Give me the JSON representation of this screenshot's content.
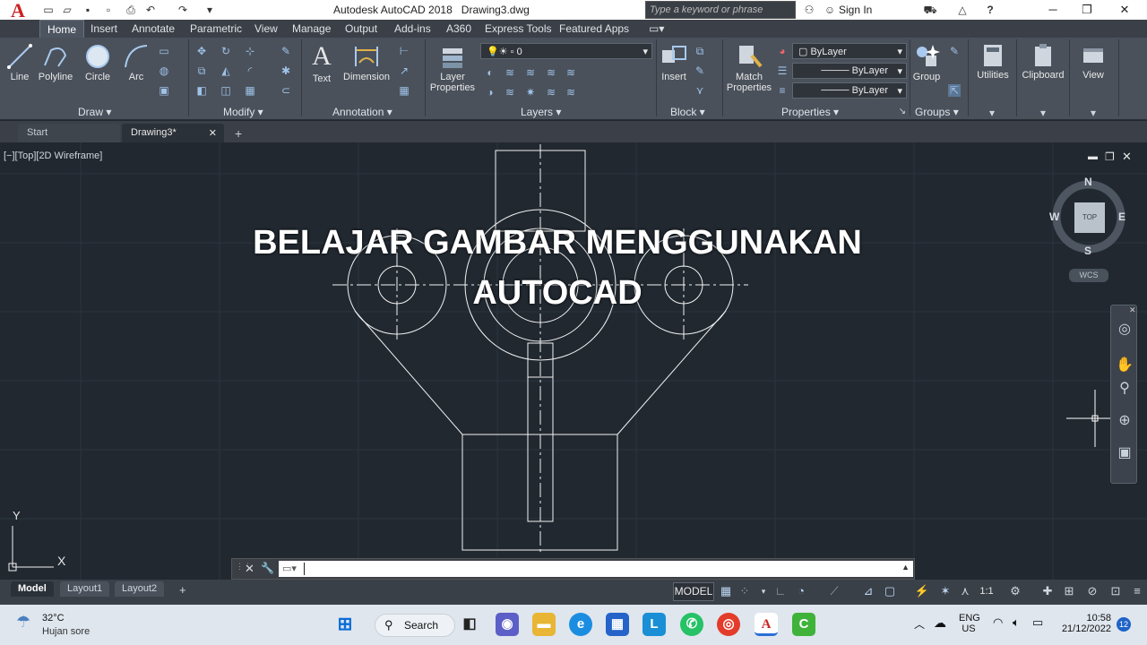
{
  "app": {
    "logo_letter": "A",
    "title": "Autodesk AutoCAD 2018",
    "document": "Drawing3.dwg",
    "search_placeholder": "Type a keyword or phrase",
    "signin_label": "Sign In",
    "help_label": "?"
  },
  "ribbon": {
    "tabs": [
      "Home",
      "Insert",
      "Annotate",
      "Parametric",
      "View",
      "Manage",
      "Output",
      "Add-ins",
      "A360",
      "Express Tools",
      "Featured Apps"
    ],
    "active_tab": "Home",
    "draw": {
      "title": "Draw",
      "line": "Line",
      "polyline": "Polyline",
      "circle": "Circle",
      "arc": "Arc"
    },
    "modify": {
      "title": "Modify"
    },
    "annotation": {
      "title": "Annotation",
      "text": "Text",
      "dimension": "Dimension"
    },
    "layers": {
      "title": "Layers",
      "layer_properties_1": "Layer",
      "layer_properties_2": "Properties",
      "current_layer": "0"
    },
    "block": {
      "title": "Block",
      "insert": "Insert"
    },
    "properties": {
      "title": "Properties",
      "match_1": "Match",
      "match_2": "Properties",
      "color": "ByLayer",
      "linetype": "ByLayer",
      "lineweight": "ByLayer"
    },
    "groups": {
      "title": "Groups",
      "group": "Group"
    },
    "utilities": {
      "label": "Utilities"
    },
    "clipboard": {
      "label": "Clipboard"
    },
    "view": {
      "label": "View"
    }
  },
  "doc_tabs": {
    "start": "Start",
    "drawing": "Drawing3*",
    "add": "+"
  },
  "viewport": {
    "label": "[−][Top][2D Wireframe]",
    "overlay_line1": "BELAJAR GAMBAR MENGGUNAKAN",
    "overlay_line2": "AUTOCAD",
    "compass": {
      "n": "N",
      "s": "S",
      "e": "E",
      "w": "W",
      "center": "TOP"
    },
    "wcs": "WCS",
    "ucs_x": "X",
    "ucs_y": "Y"
  },
  "layout_tabs": {
    "model": "Model",
    "layout1": "Layout1",
    "layout2": "Layout2",
    "add": "+"
  },
  "status": {
    "model": "MODEL",
    "scale": "1:1"
  },
  "taskbar": {
    "weather_temp": "32°C",
    "weather_desc": "Hujan sore",
    "search": "Search",
    "lang_1": "ENG",
    "lang_2": "US",
    "time": "10:58",
    "date": "21/12/2022",
    "notif_count": "12"
  },
  "colors": {
    "viewport_bg": "#212830",
    "ribbon_bg": "#4a515b",
    "accent_red": "#cc2222"
  }
}
